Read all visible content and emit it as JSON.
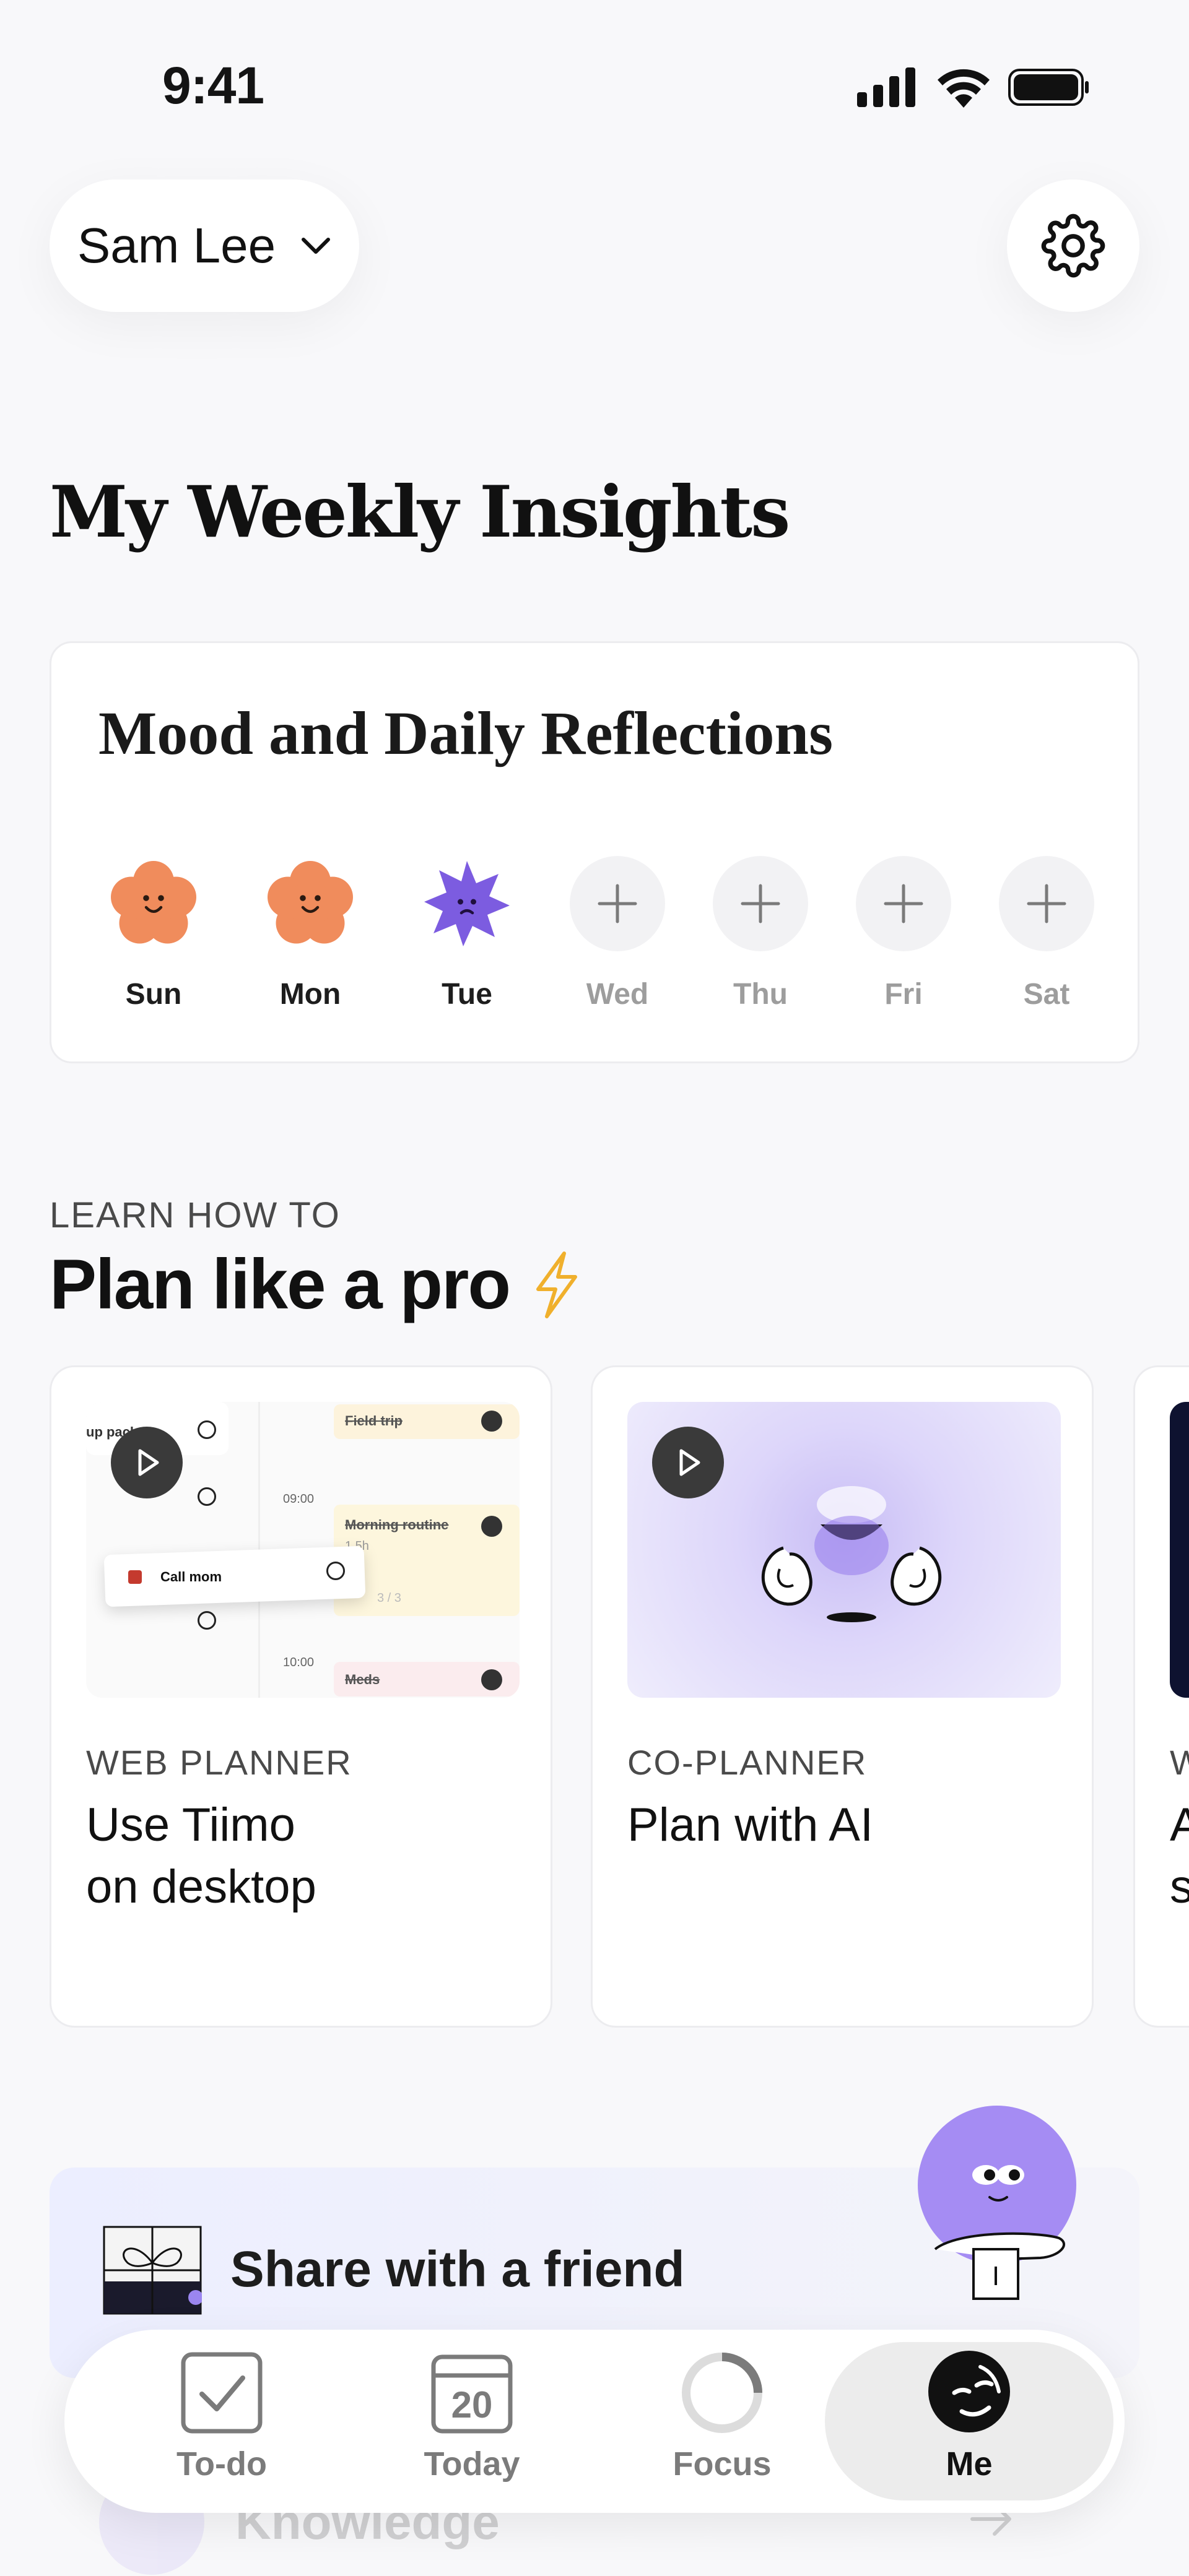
{
  "status_bar": {
    "time": "9:41"
  },
  "header": {
    "user_name": "Sam Lee"
  },
  "page_title": "My Weekly Insights",
  "mood_card": {
    "title": "Mood and Daily Reflections",
    "days": [
      {
        "label": "Sun",
        "state": "happy",
        "color": "#f08c5c"
      },
      {
        "label": "Mon",
        "state": "happy",
        "color": "#f08c5c"
      },
      {
        "label": "Tue",
        "state": "sad",
        "color": "#7c5ce0"
      },
      {
        "label": "Wed",
        "state": "empty"
      },
      {
        "label": "Thu",
        "state": "empty"
      },
      {
        "label": "Fri",
        "state": "empty"
      },
      {
        "label": "Sat",
        "state": "empty"
      }
    ]
  },
  "learn": {
    "eyebrow": "LEARN HOW TO",
    "title": "Plan like a pro",
    "cards": [
      {
        "eyebrow": "WEB PLANNER",
        "title_line1": "Use Tiimo",
        "title_line2": "on desktop",
        "thumb": {
          "row1": "up package",
          "event1": "Field trip",
          "time1": "09:00",
          "event2": "Morning routine",
          "event2_dur": "1.5h",
          "progress": "3 / 3",
          "drag_item": "Call mom",
          "time2": "10:00",
          "event3": "Meds"
        }
      },
      {
        "eyebrow": "CO-PLANNER",
        "title_line1": "Plan with AI",
        "title_line2": ""
      },
      {
        "eyebrow": "W",
        "title_line1": "A",
        "title_line2": "s"
      }
    ]
  },
  "share": {
    "label": "Share with a friend"
  },
  "knowledge": {
    "label": "Knowledge"
  },
  "tabs": [
    {
      "label": "To-do",
      "icon": "checkbox-icon"
    },
    {
      "label": "Today",
      "icon": "calendar-icon",
      "date": "20"
    },
    {
      "label": "Focus",
      "icon": "focus-ring-icon"
    },
    {
      "label": "Me",
      "icon": "avatar-face-icon",
      "active": true
    }
  ],
  "colors": {
    "accent": "#8b6cf0",
    "background": "#f8f8fa",
    "happy": "#f08c5c",
    "sad": "#7c5ce0"
  }
}
